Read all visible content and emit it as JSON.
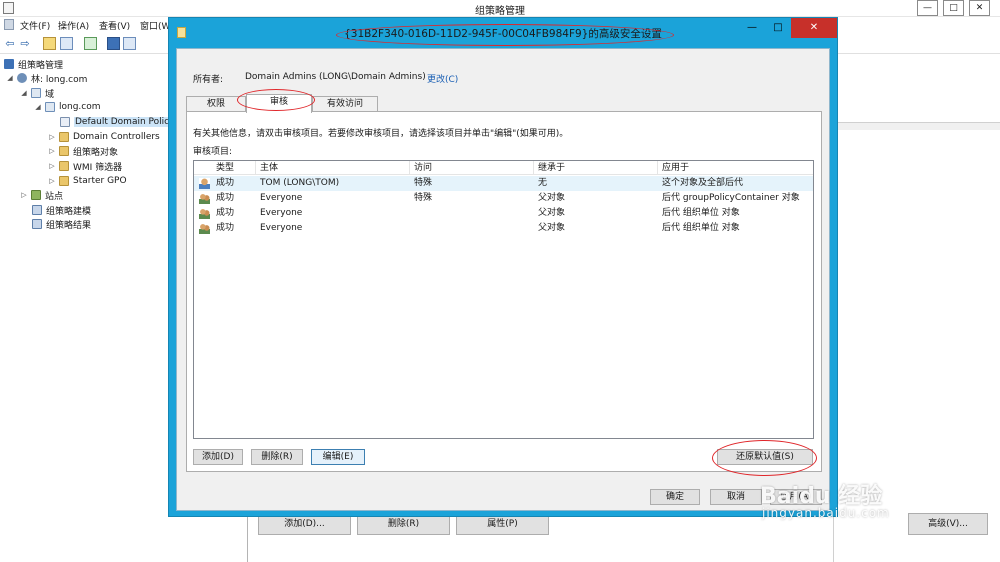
{
  "window": {
    "title": "组策略管理",
    "controls": {
      "minimize": "—",
      "maximize": "□",
      "close": "✕"
    }
  },
  "menu": [
    "文件(F)",
    "操作(A)",
    "查看(V)",
    "窗口(W"
  ],
  "tree": {
    "items": [
      {
        "label": "组策略管理",
        "expander": "",
        "icon": "gpm-icon"
      },
      {
        "label": "林: long.com",
        "expander": "◢",
        "icon": "forest-icon"
      },
      {
        "label": "域",
        "expander": "◢",
        "icon": "domains-folder-icon"
      },
      {
        "label": "long.com",
        "expander": "◢",
        "icon": "domain-icon"
      },
      {
        "label": "Default Domain Policy",
        "expander": "",
        "icon": "gpo-link-icon",
        "selected": true
      },
      {
        "label": "Domain Controllers",
        "expander": "▷",
        "icon": "ou-folder-icon"
      },
      {
        "label": "组策略对象",
        "expander": "▷",
        "icon": "gpo-folder-icon"
      },
      {
        "label": "WMI 筛选器",
        "expander": "▷",
        "icon": "wmi-folder-icon"
      },
      {
        "label": "Starter GPO",
        "expander": "▷",
        "icon": "starter-gpo-folder-icon"
      },
      {
        "label": "站点",
        "expander": "▷",
        "icon": "sites-icon"
      },
      {
        "label": "组策略建模",
        "expander": "",
        "icon": "modeling-icon"
      },
      {
        "label": "组策略结果",
        "expander": "",
        "icon": "results-icon"
      }
    ]
  },
  "background_buttons": {
    "add": "添加(D)...",
    "remove": "删除(R)",
    "properties": "属性(P)",
    "advanced": "高级(V)..."
  },
  "dialog": {
    "title": "{31B2F340-016D-11D2-945F-00C04FB984F9}的高级安全设置",
    "owner_label": "所有者:",
    "owner_value": "Domain Admins (LONG\\Domain Admins)",
    "change_link": "更改(C)",
    "tabs": [
      "权限",
      "审核",
      "有效访问"
    ],
    "active_tab": "审核",
    "info_text": "有关其他信息，请双击审核项目。若要修改审核项目，请选择该项目并单击\"编辑\"(如果可用)。",
    "list_label": "审核项目:",
    "columns": [
      "类型",
      "主体",
      "访问",
      "继承于",
      "应用于"
    ],
    "rows": [
      {
        "type": "成功",
        "principal": "TOM (LONG\\TOM)",
        "access": "特殊",
        "inherited": "无",
        "applies": "这个对象及全部后代",
        "icon": "user-icon"
      },
      {
        "type": "成功",
        "principal": "Everyone",
        "access": "特殊",
        "inherited": "父对象",
        "applies": "后代 groupPolicyContainer 对象",
        "icon": "group-icon"
      },
      {
        "type": "成功",
        "principal": "Everyone",
        "access": "",
        "inherited": "父对象",
        "applies": "后代 组织单位 对象",
        "icon": "group-icon"
      },
      {
        "type": "成功",
        "principal": "Everyone",
        "access": "",
        "inherited": "父对象",
        "applies": "后代 组织单位 对象",
        "icon": "group-icon"
      }
    ],
    "buttons": {
      "add": "添加(D)",
      "remove": "删除(R)",
      "edit": "编辑(E)",
      "restore": "还原默认值(S)",
      "ok": "确定",
      "cancel": "取消",
      "apply": "应用(A)"
    }
  },
  "watermark": {
    "main": "Baidu 经验",
    "sub": "jingyan.baidu.com"
  }
}
